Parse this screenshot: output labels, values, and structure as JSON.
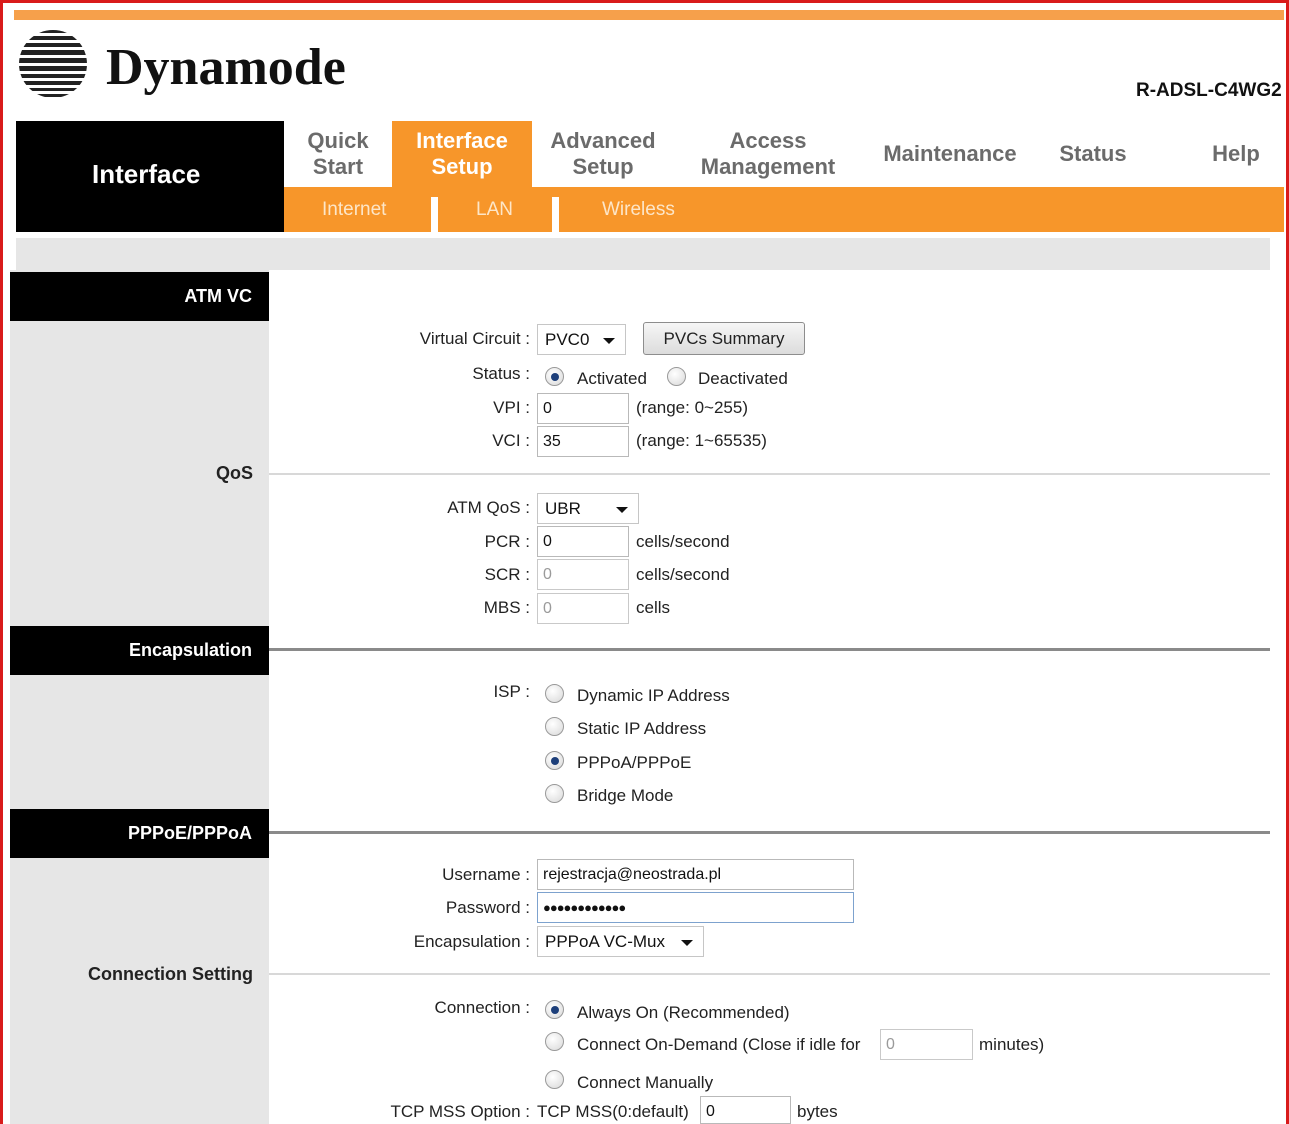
{
  "brand": {
    "name": "Dynamode",
    "model": "R-ADSL-C4WG2"
  },
  "nav": {
    "section": "Interface",
    "tabs": [
      {
        "label": "Quick\nStart"
      },
      {
        "label": "Interface\nSetup"
      },
      {
        "label": "Advanced\nSetup"
      },
      {
        "label": "Access\nManagement"
      },
      {
        "label": "Maintenance"
      },
      {
        "label": "Status"
      },
      {
        "label": "Help"
      }
    ],
    "active_tab": "Interface Setup",
    "subtabs": [
      "Internet",
      "LAN",
      "Wireless"
    ]
  },
  "sections": {
    "atm_vc": "ATM VC",
    "qos": "QoS",
    "encapsulation": "Encapsulation",
    "pppoe_pppoa": "PPPoE/PPPoA",
    "connection_setting": "Connection Setting"
  },
  "atm": {
    "virtual_circuit_label": "Virtual Circuit :",
    "virtual_circuit_value": "PVC0",
    "pvcs_summary_button": "PVCs Summary",
    "status_label": "Status :",
    "status_activated": "Activated",
    "status_deactivated": "Deactivated",
    "vpi_label": "VPI :",
    "vpi_value": "0",
    "vpi_range": "(range: 0~255)",
    "vci_label": "VCI :",
    "vci_value": "35",
    "vci_range": "(range: 1~65535)"
  },
  "qos": {
    "atm_qos_label": "ATM QoS :",
    "atm_qos_value": "UBR",
    "pcr_label": "PCR :",
    "pcr_value": "0",
    "pcr_unit": "cells/second",
    "scr_label": "SCR :",
    "scr_value": "0",
    "scr_unit": "cells/second",
    "mbs_label": "MBS :",
    "mbs_value": "0",
    "mbs_unit": "cells"
  },
  "encap": {
    "isp_label": "ISP :",
    "options": [
      "Dynamic IP Address",
      "Static IP Address",
      "PPPoA/PPPoE",
      "Bridge Mode"
    ],
    "selected": "PPPoA/PPPoE"
  },
  "ppp": {
    "username_label": "Username :",
    "username_value": "rejestracja@neostrada.pl",
    "password_label": "Password :",
    "password_value": "●●●●●●●●●●●●",
    "encapsulation_label": "Encapsulation :",
    "encapsulation_value": "PPPoA VC-Mux"
  },
  "connection": {
    "connection_label": "Connection :",
    "always_on": "Always On (Recommended)",
    "on_demand_prefix": "Connect On-Demand (Close if idle for",
    "on_demand_value": "0",
    "on_demand_suffix": "minutes)",
    "manual": "Connect Manually",
    "tcp_mss_label": "TCP MSS Option :",
    "tcp_mss_text": "TCP MSS(0:default)",
    "tcp_mss_value": "0",
    "tcp_mss_unit": "bytes"
  },
  "colors": {
    "accent": "#f7962a",
    "frame": "#d91b1b",
    "section_header": "#000000",
    "panel": "#e6e6e6"
  }
}
